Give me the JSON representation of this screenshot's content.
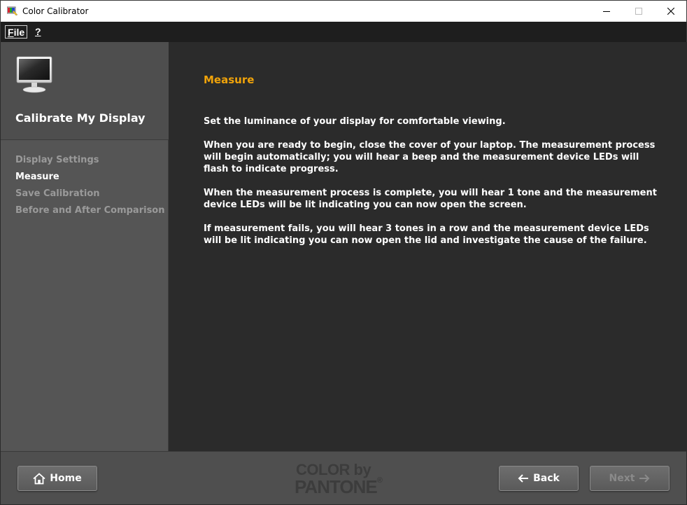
{
  "window": {
    "title": "Color Calibrator",
    "icon": "color-calibrator-app-icon",
    "controls": [
      "minimize-icon",
      "maximize-icon",
      "close-icon"
    ]
  },
  "menu": {
    "file_label_first": "F",
    "file_label_rest": "ile",
    "help_label": "?"
  },
  "sidebar": {
    "title": "Calibrate My Display",
    "icon": "monitor-icon",
    "steps": [
      {
        "label": "Display Settings",
        "active": false
      },
      {
        "label": "Measure",
        "active": true
      },
      {
        "label": "Save Calibration",
        "active": false
      },
      {
        "label": "Before and After Comparison",
        "active": false
      }
    ]
  },
  "main": {
    "heading": "Measure",
    "paragraphs": [
      "Set the luminance of your display for comfortable viewing.",
      "When you are ready to begin, close the cover of your laptop. The measurement process will begin automatically; you will hear a beep and the measurement device LEDs will flash to indicate progress.",
      "When the measurement process is complete, you will hear 1 tone and the measurement device LEDs will be lit indicating you can now open the screen.",
      "If measurement fails, you will hear 3 tones in a row and the measurement device LEDs will be lit indicating you can now open the lid and investigate the cause of the failure."
    ]
  },
  "footer": {
    "home_label": "Home",
    "back_label": "Back",
    "next_label": "Next",
    "logo_line1": "COLOR by",
    "logo_line2": "PANTONE",
    "logo_reg": "®"
  },
  "colors": {
    "accent": "#f0a30a",
    "background": "#2b2b2b",
    "sidebar": "#555555",
    "disabled_text": "#9a9a9a"
  }
}
